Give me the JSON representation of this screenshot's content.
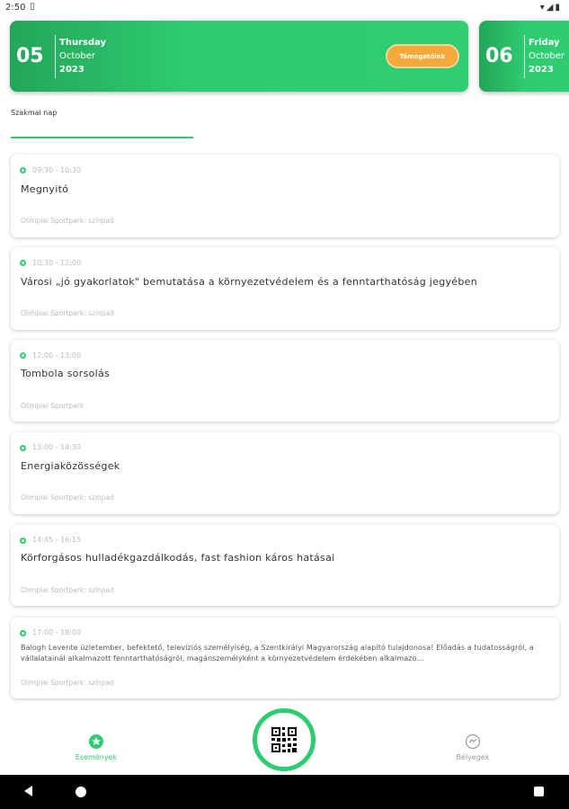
{
  "status_bar": {
    "time": "2:50",
    "sim_icon": "sim-card-icon",
    "right_icons": [
      "wifi-icon",
      "signal-icon",
      "battery-icon"
    ]
  },
  "dates": [
    {
      "day": "05",
      "weekday": "Thursday",
      "month": "October",
      "year": "2023",
      "sponsor_label": "Támogatóink"
    },
    {
      "day": "06",
      "weekday": "Friday",
      "month": "October",
      "year": "2023"
    }
  ],
  "tab": {
    "label": "Szakmai nap"
  },
  "events": [
    {
      "time": "09:30 - 10:30",
      "title": "Megnyitó",
      "place": "Olimpiai Sportpark: színpad"
    },
    {
      "time": "10:30 - 12:00",
      "title": "Városi „jó gyakorlatok\" bemutatása a környezetvédelem és a fenntarthatóság jegyében",
      "place": "Olimpiai Sportpark: színpad"
    },
    {
      "time": "12:00 - 13:00",
      "title": "Tombola sorsolás",
      "place": "Olimpiai Sportpark"
    },
    {
      "time": "13:00 - 14:30",
      "title": "Energiaközösségek",
      "place": "Olimpiai Sportpark: színpad"
    },
    {
      "time": "14:45 - 16:15",
      "title": "Körforgásos hulladékgazdálkodás, fast fashion káros hatásai",
      "place": "Olimpiai Sportpark: színpad"
    },
    {
      "time": "17:00 - 18:00",
      "description": "Balogh Levente üzletember, befektető, televíziós személyiség, a Szentkirályi Magyarország alapító tulajdonosa! Előadás a tudatosságról, a vállalatainál alkalmazott fenntarthatóságról, magánszemélyként a környezetvédelem érdekében alkalmazo...",
      "place": "Olimpiai Sportpark: színpad"
    }
  ],
  "bottom_nav": {
    "events_label": "Események",
    "stamps_label": "Bélyegek"
  },
  "colors": {
    "accent": "#2ecc71",
    "sponsor": "#f5a93b"
  }
}
